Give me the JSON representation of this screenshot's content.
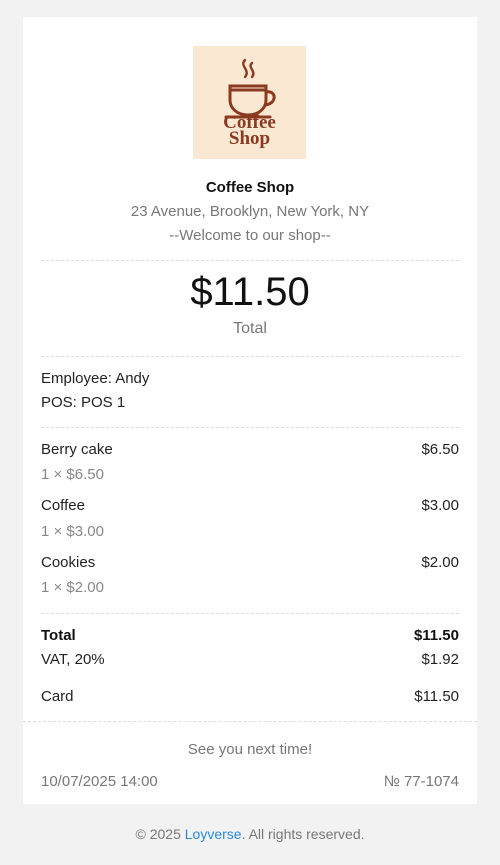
{
  "logo": {
    "line1": "Coffee",
    "line2": "Shop",
    "colors": {
      "background": "#fbe8d3",
      "ink": "#8a3a1f"
    },
    "icon": "coffee-cup-icon"
  },
  "shop": {
    "name": "Coffee Shop",
    "address": "23 Avenue, Brooklyn, New York, NY",
    "welcome": "--Welcome to our shop--"
  },
  "summary": {
    "total_amount": "$11.50",
    "total_caption": "Total"
  },
  "staff": {
    "employee": "Employee: Andy",
    "pos": "POS: POS 1"
  },
  "items": [
    {
      "name": "Berry cake",
      "qty_price": "1 × $6.50",
      "amount": "$6.50"
    },
    {
      "name": "Coffee",
      "qty_price": "1 × $3.00",
      "amount": "$3.00"
    },
    {
      "name": "Cookies",
      "qty_price": "1 × $2.00",
      "amount": "$2.00"
    }
  ],
  "totals": {
    "total_label": "Total",
    "total_value": "$11.50",
    "vat_label": "VAT, 20%",
    "vat_value": "$1.92",
    "payment_label": "Card",
    "payment_value": "$11.50"
  },
  "footer": {
    "goodbye": "See you next time!",
    "datetime": "10/07/2025 14:00",
    "receipt_number": "№ 77-1074"
  },
  "copyright": {
    "prefix": "© 2025 ",
    "brand": "Loyverse",
    "suffix": ". All rights reserved.",
    "link_color": "#2b8ad8"
  }
}
